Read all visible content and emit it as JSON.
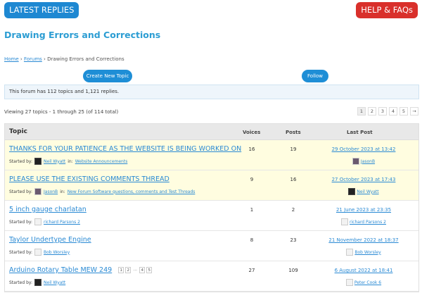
{
  "header": {
    "latest_replies": "LATEST REPLIES",
    "help": "HELP & FAQs"
  },
  "page_title": "Drawing Errors and Corrections",
  "breadcrumb": {
    "home": "Home",
    "forums": "Forums",
    "current": "Drawing Errors and Corrections",
    "sep": "›"
  },
  "actions": {
    "new_topic": "Create New Topic",
    "follow": "Follow"
  },
  "info": "This forum has 112 topics and 1,121 replies.",
  "viewing": "Viewing 27 topics - 1 through 25 (of 114 total)",
  "pager": [
    "1",
    "2",
    "3",
    "4",
    "5",
    "→"
  ],
  "table": {
    "headers": {
      "topic": "Topic",
      "voices": "Voices",
      "posts": "Posts",
      "last_post": "Last Post"
    },
    "started_by": "Started by:",
    "in": "in:",
    "rows": [
      {
        "title": "THANKS FOR YOUR PATIENCE AS THE WEBSITE IS BEING WORKED ON",
        "author": "Neil Wyatt",
        "forum": "Website Announcements",
        "voices": "16",
        "posts": "19",
        "last_date": "29 October 2023 at 13:42",
        "last_user": "JasonB"
      },
      {
        "title": "PLEASE USE THE EXISTING COMMENTS THREAD",
        "author": "JasonB",
        "forum": "New Forum Software questions, comments and Test Threads",
        "voices": "9",
        "posts": "16",
        "last_date": "27 October 2023 at 17:43",
        "last_user": "Neil Wyatt"
      },
      {
        "title": "5 inch gauge charlatan",
        "author": "richard Parsons 2",
        "voices": "1",
        "posts": "2",
        "last_date": "21 June 2023 at 23:35",
        "last_user": "richard Parsons 2"
      },
      {
        "title": "Taylor Undertype Engine",
        "author": "Bob Worsley",
        "voices": "8",
        "posts": "23",
        "last_date": "21 November 2022 at 18:37",
        "last_user": "Bob Worsley"
      },
      {
        "title": "Arduino Rotary Table MEW 249",
        "pages": [
          "1",
          "2",
          "…",
          "4",
          "5"
        ],
        "author": "Neil Wyatt",
        "voices": "27",
        "posts": "109",
        "last_date": "6 August 2022 at 18:41",
        "last_user": "Peter Cook 6"
      }
    ]
  }
}
